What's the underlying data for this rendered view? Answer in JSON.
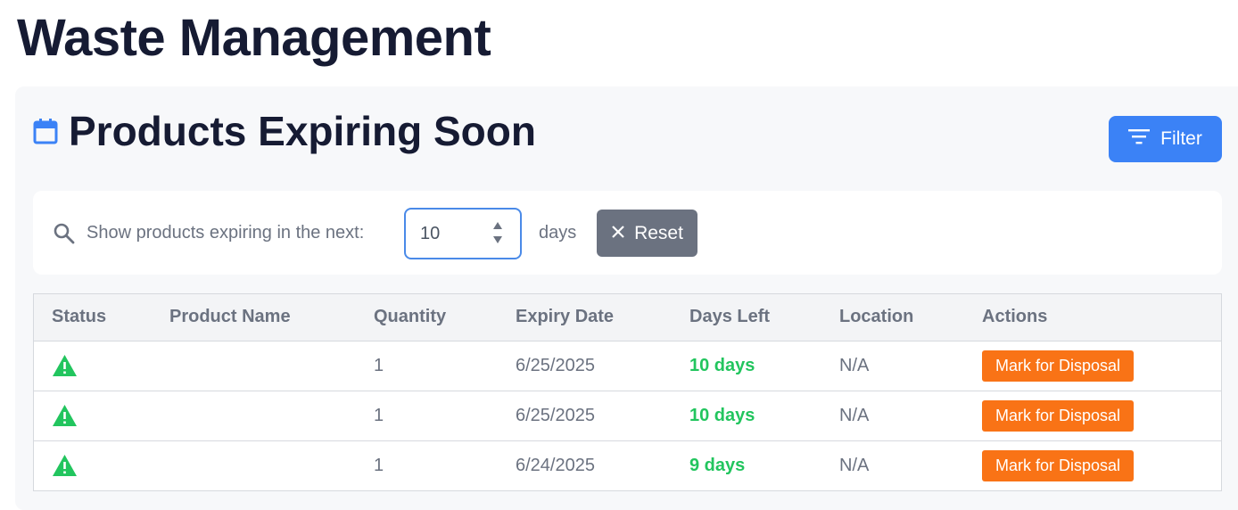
{
  "page": {
    "title": "Waste Management"
  },
  "section": {
    "title": "Products Expiring Soon",
    "icon": "calendar-icon",
    "filter_label": "Filter"
  },
  "filter_bar": {
    "label": "Show products expiring in the next:",
    "days_value": "10",
    "unit": "days",
    "reset_label": "Reset"
  },
  "table": {
    "headers": [
      "Status",
      "Product Name",
      "Quantity",
      "Expiry Date",
      "Days Left",
      "Location",
      "Actions"
    ],
    "rows": [
      {
        "status_icon": "warning-icon",
        "product_name": "",
        "quantity": "1",
        "expiry_date": "6/25/2025",
        "days_left": "10 days",
        "location": "N/A",
        "action": "Mark for Disposal"
      },
      {
        "status_icon": "warning-icon",
        "product_name": "",
        "quantity": "1",
        "expiry_date": "6/25/2025",
        "days_left": "10 days",
        "location": "N/A",
        "action": "Mark for Disposal"
      },
      {
        "status_icon": "warning-icon",
        "product_name": "",
        "quantity": "1",
        "expiry_date": "6/24/2025",
        "days_left": "9 days",
        "location": "N/A",
        "action": "Mark for Disposal"
      }
    ]
  },
  "colors": {
    "primary": "#3b82f6",
    "reset": "#6b7280",
    "dispose": "#f97316",
    "days_left": "#22c55e",
    "warning": "#22c55e"
  }
}
